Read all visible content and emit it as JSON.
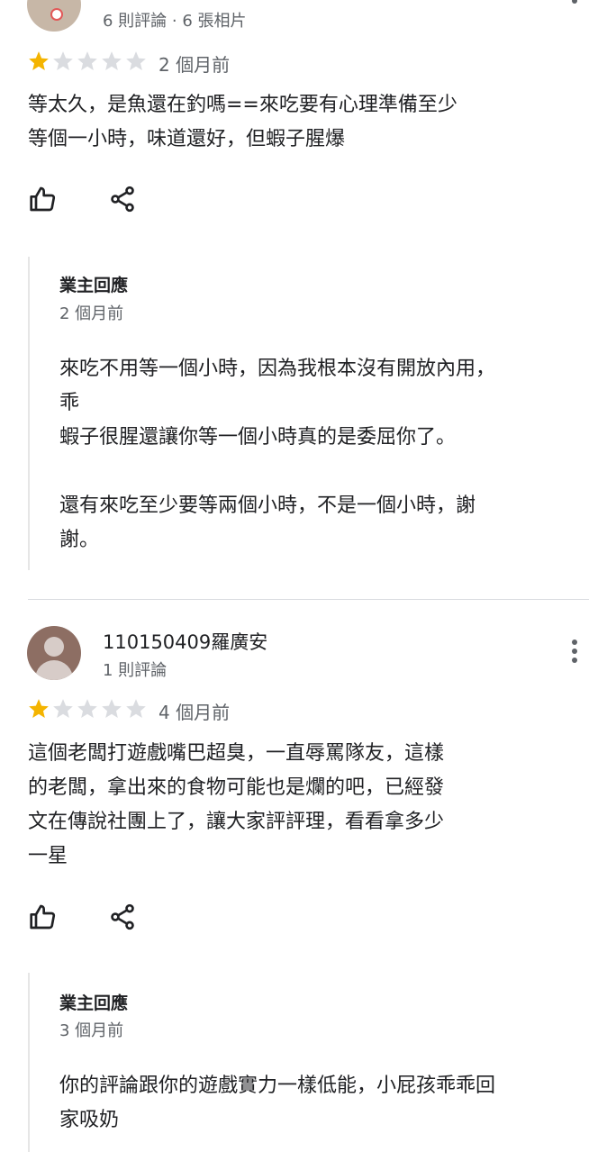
{
  "reviews": [
    {
      "user_meta": "6 則評論 · 6 張相片",
      "rating": 1,
      "rating_max": 5,
      "time": "2 個月前",
      "text": "等太久，是魚還在釣嗎==來吃要有心理準備至少\n等個一小時，味道還好，但蝦子腥爆",
      "like_icon": "thumb-up-icon",
      "share_icon": "share-icon",
      "reply": {
        "title": "業主回應",
        "time": "2 個月前",
        "text": "來吃不用等一個小時，因為我根本沒有開放內用，\n乖\n蝦子很腥還讓你等一個小時真的是委屈你了。\n\n還有來吃至少要等兩個小時，不是一個小時，謝\n謝。"
      }
    },
    {
      "user_name": "110150409羅廣安",
      "user_meta": "1 則評論",
      "rating": 1,
      "rating_max": 5,
      "time": "4 個月前",
      "text": "這個老闆打遊戲嘴巴超臭，一直辱罵隊友，這樣\n的老闆，拿出來的食物可能也是爛的吧，已經發\n文在傳說社團上了，讓大家評評理，看看拿多少\n一星",
      "like_icon": "thumb-up-icon",
      "share_icon": "share-icon",
      "reply": {
        "title": "業主回應",
        "time": "3 個月前",
        "text": "你的評論跟你的遊戲實力一樣低能，小屁孩乖乖回\n家吸奶"
      }
    }
  ],
  "colors": {
    "star_filled": "#f4b400",
    "star_empty": "#dadce0",
    "text": "#202124",
    "secondary_text": "#5f6368"
  }
}
